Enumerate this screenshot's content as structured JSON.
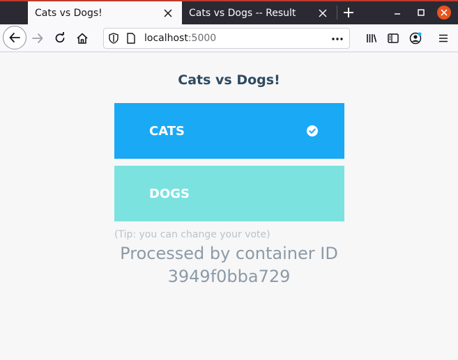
{
  "browser": {
    "tabs": [
      {
        "title": "Cats vs Dogs!",
        "active": true
      },
      {
        "title": "Cats vs Dogs -- Result",
        "active": false
      }
    ],
    "url_host": "localhost",
    "url_port": ":5000",
    "icons": {
      "back": "back-arrow-icon",
      "forward": "forward-arrow-icon",
      "reload": "reload-icon",
      "home": "home-icon",
      "library": "library-icon",
      "sidebar": "sidebar-icon",
      "account": "account-icon",
      "menu": "hamburger-menu-icon"
    },
    "colors": {
      "tabstrip": "#2b2a33",
      "window_close": "#e95420"
    }
  },
  "page": {
    "title": "Cats vs Dogs!",
    "options": [
      {
        "label": "CATS",
        "selected": true,
        "color": "#1aa9f5"
      },
      {
        "label": "DOGS",
        "selected": false,
        "color": "#7be2e0"
      }
    ],
    "tip": "(Tip: you can change your vote)",
    "processed_by": "Processed by container ID",
    "container_id": "3949f0bba729"
  }
}
